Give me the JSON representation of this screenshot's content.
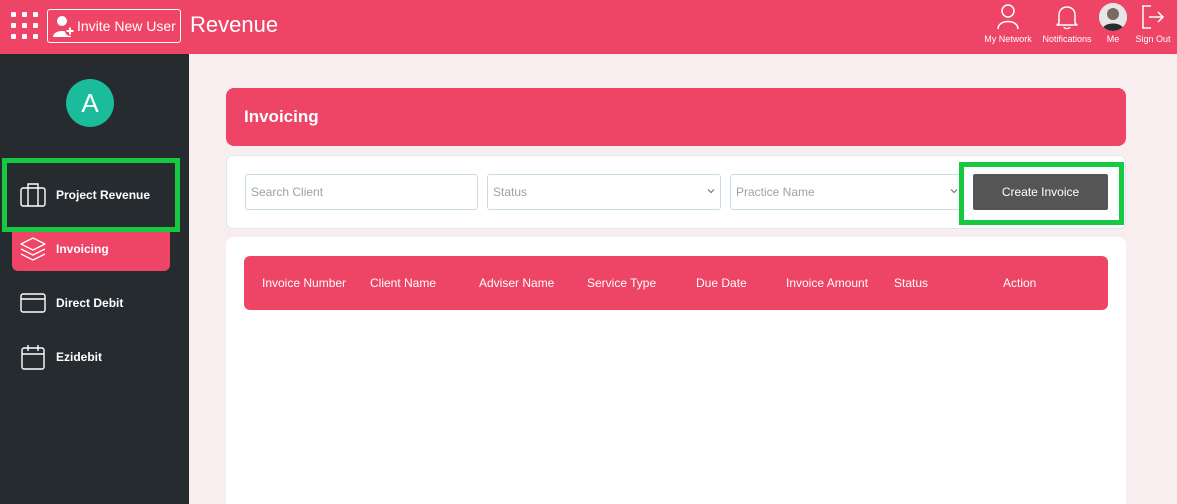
{
  "topbar": {
    "invite_label": "Invite New User",
    "title": "Revenue",
    "nav": [
      {
        "label": "My Network",
        "icon": "person-icon"
      },
      {
        "label": "Notifications",
        "icon": "bell-icon"
      },
      {
        "label": "Me",
        "icon": "avatar"
      },
      {
        "label": "Sign Out",
        "icon": "sign-out-icon"
      }
    ]
  },
  "sidebar": {
    "avatar_letter": "A",
    "items": [
      {
        "label": "Project Revenue",
        "icon": "briefcase-icon"
      },
      {
        "label": "Invoicing",
        "icon": "layers-icon",
        "active": true
      },
      {
        "label": "Direct Debit",
        "icon": "card-icon"
      },
      {
        "label": "Ezidebit",
        "icon": "calendar-icon"
      }
    ]
  },
  "main": {
    "title": "Invoicing",
    "filters": {
      "search_placeholder": "Search Client",
      "status_placeholder": "Status",
      "practice_placeholder": "Practice Name",
      "create_label": "Create Invoice"
    },
    "table": {
      "columns": [
        "Invoice Number",
        "Client Name",
        "Adviser Name",
        "Service Type",
        "Due Date",
        "Invoice Amount",
        "Status",
        "Action"
      ]
    }
  },
  "colors": {
    "brand": "#ee4466",
    "sidebar_bg": "#252b2f",
    "avatar_bg": "#1bbc9b",
    "highlight": "#16c940",
    "button_dark": "#555555"
  }
}
